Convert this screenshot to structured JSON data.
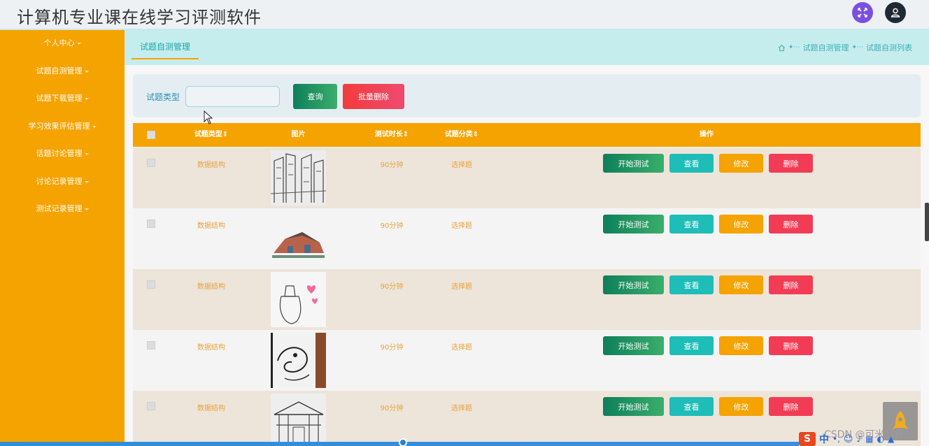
{
  "header": {
    "title": "计算机专业课在线学习评测软件",
    "colors": {
      "fullscreen_button": "#7b4fe0",
      "user_button": "#1e2a33"
    }
  },
  "sidebar": {
    "items": [
      {
        "label": "个人中心"
      },
      {
        "label": "试题自测管理"
      },
      {
        "label": "试题下载管理"
      },
      {
        "label": "学习效果评估管理"
      },
      {
        "label": "话题讨论管理"
      },
      {
        "label": "讨论记录管理"
      },
      {
        "label": "测试记录管理"
      }
    ],
    "color": "#f5a300"
  },
  "tab": {
    "label": "试题自测管理"
  },
  "breadcrumb": {
    "items": [
      "试题自测管理",
      "试题自测列表"
    ]
  },
  "search": {
    "label": "试题类型",
    "value": "",
    "placeholder": "",
    "query_label": "查询",
    "bulk_delete_label": "批量删除"
  },
  "table": {
    "headers": {
      "type": "试题类型",
      "image": "图片",
      "duration": "测试时长",
      "category": "试题分类",
      "actions": "操作"
    },
    "rows": [
      {
        "type": "数据结构",
        "duration": "90分钟",
        "category": "选择题",
        "image": "city-street-sketch"
      },
      {
        "type": "数据结构",
        "duration": "90分钟",
        "category": "选择题",
        "image": "house-watercolor"
      },
      {
        "type": "数据结构",
        "duration": "90分钟",
        "category": "选择题",
        "image": "bottle-hearts-drawing"
      },
      {
        "type": "数据结构",
        "duration": "90分钟",
        "category": "选择题",
        "image": "dragon-ink-drawing"
      },
      {
        "type": "数据结构",
        "duration": "90分钟",
        "category": "选择题",
        "image": "chinese-gate-sketch"
      }
    ],
    "action_labels": {
      "start": "开始测试",
      "view": "查看",
      "edit": "修改",
      "delete": "删除"
    }
  },
  "watermark": "CSDN @可米科技",
  "ime": {
    "lang": "中",
    "logo": "S"
  }
}
